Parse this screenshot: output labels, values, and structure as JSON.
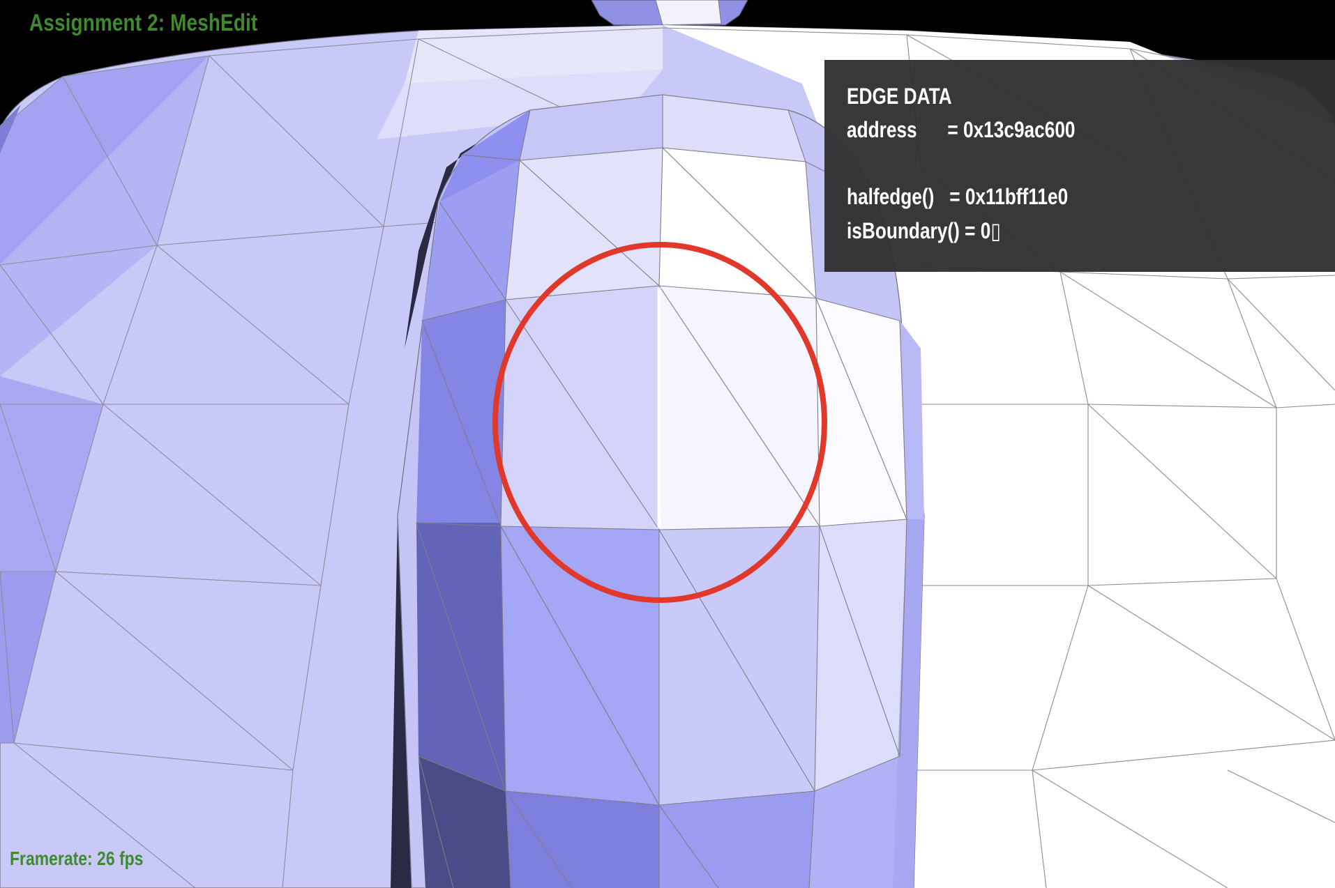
{
  "app": {
    "title": "Assignment 2: MeshEdit"
  },
  "status": {
    "framerate": "Framerate: 26 fps"
  },
  "edge_panel": {
    "heading": "EDGE DATA",
    "address_line": "address      = 0x13c9ac600",
    "halfedge_line": "halfedge()   = 0x11bff11e0",
    "boundary_line": "isBoundary() = 0▯"
  },
  "colors": {
    "background": "#000000",
    "title_green": "#3f8a2e",
    "panel_bg": "#323232",
    "selection_circle": "#e0392b",
    "selected_edge": "#ffffff",
    "wire": "#7d7d7d"
  }
}
